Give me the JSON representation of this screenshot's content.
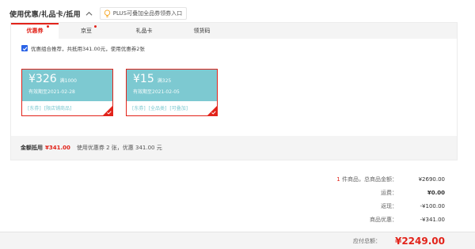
{
  "header": {
    "title": "使用优惠/礼品卡/抵用",
    "plus_text": "PLUS可叠加全品券领券入口"
  },
  "tabs": [
    {
      "label": "优惠券",
      "dot": true,
      "active": true
    },
    {
      "label": "京豆",
      "dot": true,
      "active": false
    },
    {
      "label": "礼品卡",
      "dot": false,
      "active": false
    },
    {
      "label": "领货码",
      "dot": false,
      "active": false
    }
  ],
  "combo": {
    "checked": true,
    "text": "优惠组合推荐，共抵用341.00元，使用优惠券2张"
  },
  "coupons": [
    {
      "currency": "¥",
      "value": "326",
      "condition": "满1000",
      "expiry": "有效期至2021-02-28",
      "tag1": "[东券]",
      "tag2": "[限店铺商品]",
      "selected": true
    },
    {
      "currency": "¥",
      "value": "15",
      "condition": "满325",
      "expiry": "有效期至2021-02-05",
      "tag1": "[东券]",
      "tag2": "[全品类]",
      "tag3": "[可叠加]",
      "selected": true
    }
  ],
  "summary": {
    "label": "金额抵用",
    "amount": "¥341.00",
    "desc": "使用优惠券 2 张，优惠 341.00 元"
  },
  "totals": {
    "items_count": "1",
    "items_label": "件商品，总商品金额：",
    "items_value": "¥2690.00",
    "shipping_label": "运费：",
    "shipping_value": "¥0.00",
    "cashback_label": "返现：",
    "cashback_value": "-¥100.00",
    "discount_label": "商品优惠：",
    "discount_value": "-¥341.00"
  },
  "footer": {
    "label": "应付总额：",
    "value": "¥2249.00"
  },
  "colors": {
    "accent": "#e2231a",
    "coupon": "#7dc9d1",
    "checkbox": "#2a63e6"
  }
}
